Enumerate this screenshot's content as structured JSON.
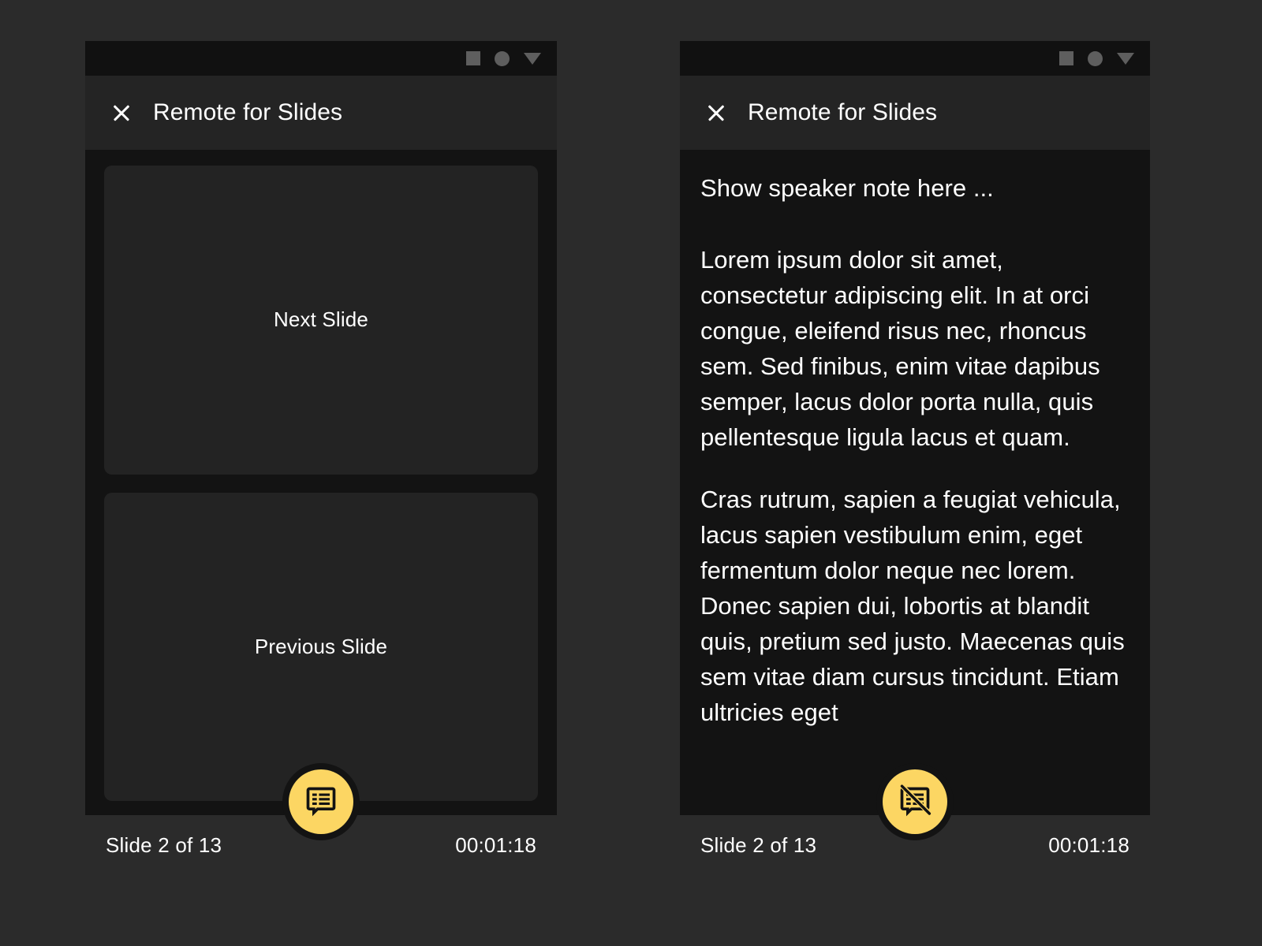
{
  "theme": {
    "page_background": "#2b2b2b",
    "panel_background": "#131313",
    "appbar_background": "#242424",
    "card_background": "#232323",
    "statusbar_background": "#2b2b2b",
    "accent": "#FCD663",
    "text_primary": "#ffffff",
    "nav_icon": "#5e5e5e"
  },
  "system_nav": {
    "recents_icon": "square-icon",
    "home_icon": "circle-icon",
    "back_icon": "triangle-icon"
  },
  "appbar": {
    "close_icon": "close-icon",
    "title": "Remote for Slides"
  },
  "left_panel": {
    "cards": [
      {
        "label": "Next Slide"
      },
      {
        "label": "Previous Slide"
      }
    ],
    "fab": {
      "icon": "speaker-notes-icon",
      "state": "notes-hidden"
    },
    "statusbar": {
      "slide_count": "Slide 2 of 13",
      "timer": "00:01:18"
    }
  },
  "right_panel": {
    "notes": [
      "Show speaker note here ...",
      "Lorem ipsum dolor sit amet, consectetur adipiscing elit. In at orci congue, eleifend risus nec, rhoncus sem. Sed finibus, enim vitae dapibus semper, lacus dolor porta nulla, quis pellentesque ligula lacus et quam.",
      "Cras rutrum, sapien a feugiat vehicula, lacus sapien vestibulum enim, eget fermentum dolor neque nec lorem. Donec sapien dui, lobortis at blandit quis, pretium sed justo. Maecenas quis sem vitae diam cursus tincidunt. Etiam ultricies eget"
    ],
    "fab": {
      "icon": "speaker-notes-off-icon",
      "state": "notes-shown"
    },
    "statusbar": {
      "slide_count": "Slide 2 of 13",
      "timer": "00:01:18"
    }
  }
}
